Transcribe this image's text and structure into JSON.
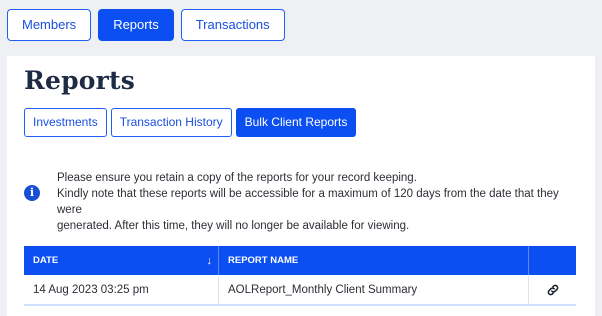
{
  "top_tabs": [
    {
      "label": "Members",
      "active": false
    },
    {
      "label": "Reports",
      "active": true
    },
    {
      "label": "Transactions",
      "active": false
    }
  ],
  "page_title": "Reports",
  "sub_tabs": [
    {
      "label": "Investments",
      "active": false
    },
    {
      "label": "Transaction History",
      "active": false
    },
    {
      "label": "Bulk Client Reports",
      "active": true
    }
  ],
  "notice": {
    "icon": "info-icon",
    "line1": "Please ensure you retain a copy of the reports for your record keeping.",
    "line2": "Kindly note that these reports will be accessible for a maximum of 120 days from the date that they were",
    "line3": "generated. After this time, they will no longer be available for viewing."
  },
  "table": {
    "columns": {
      "date": "DATE",
      "report_name": "REPORT NAME",
      "sort_indicator": "↓"
    },
    "rows": [
      {
        "date": "14 Aug 2023 03:25 pm",
        "report_name": "AOLReport_Monthly Client Summary",
        "action_icon": "link-icon"
      }
    ]
  },
  "colors": {
    "accent": "#0b4ff2",
    "info_icon": "#1b4ed8",
    "title": "#1d2b44"
  }
}
